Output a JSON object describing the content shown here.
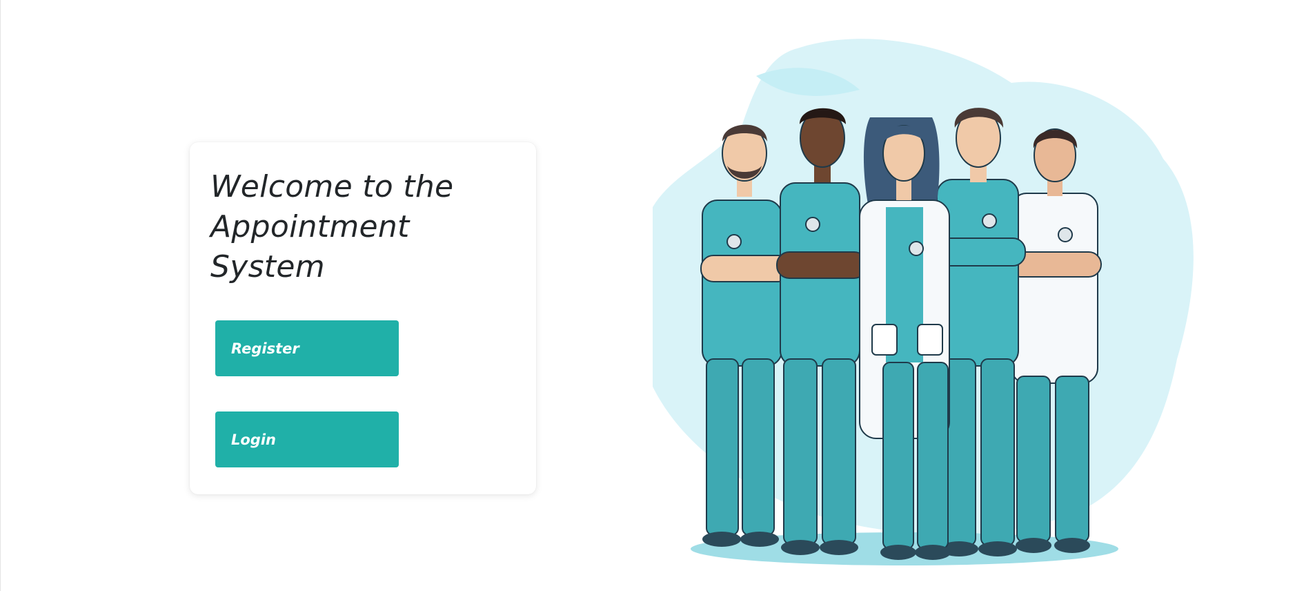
{
  "welcome_card": {
    "title": "Welcome to the Appointment System",
    "register_label": "Register",
    "login_label": "Login"
  },
  "illustration": {
    "subject": "doctors-team-illustration"
  },
  "colors": {
    "accent": "#20b0a8",
    "title_text": "#222629",
    "scrubs": "#45b6bf",
    "background_blob": "#d9f3f8"
  }
}
